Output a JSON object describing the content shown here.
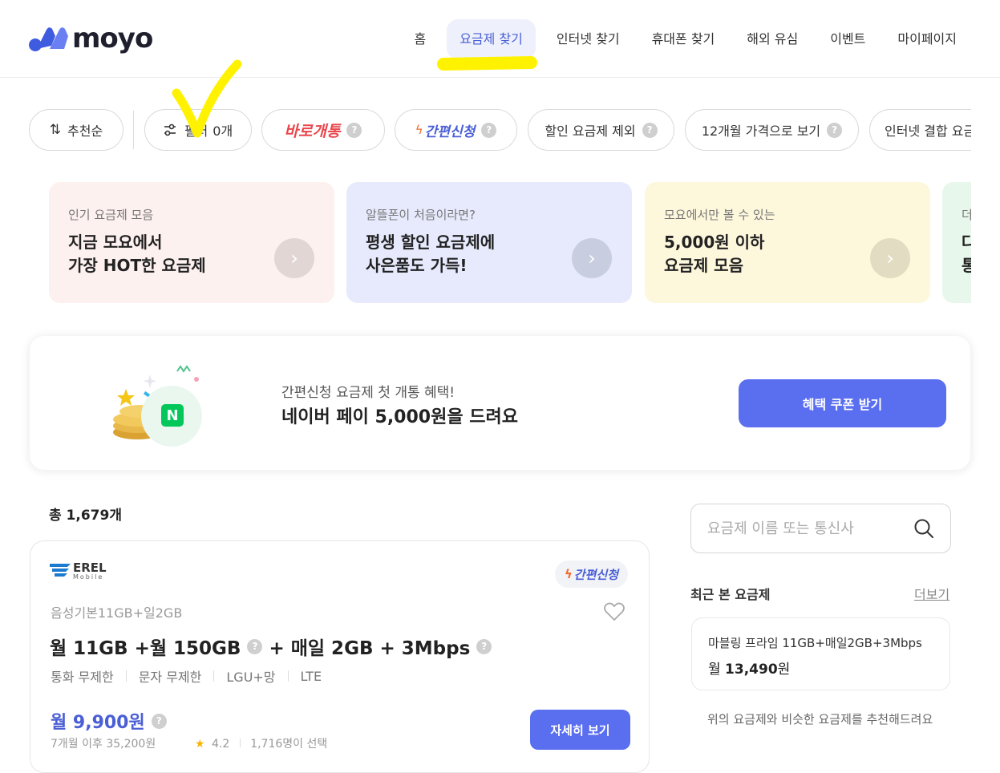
{
  "brand": {
    "name": "moyo"
  },
  "nav": {
    "items": [
      {
        "label": "홈"
      },
      {
        "label": "요금제 찾기"
      },
      {
        "label": "인터넷 찾기"
      },
      {
        "label": "휴대폰 찾기"
      },
      {
        "label": "해외 유심"
      },
      {
        "label": "이벤트"
      },
      {
        "label": "마이페이지"
      }
    ],
    "active_index": 1
  },
  "filters": {
    "sort_label": "추천순",
    "filter_label": "필터",
    "filter_count": "0개",
    "instant_open": "바로개통",
    "easy_apply": "간편신청",
    "exclude_discount": "할인 요금제 제외",
    "twelve_month": "12개월 가격으로 보기",
    "internet_bundle": "인터넷 결합 요금"
  },
  "promos": [
    {
      "sub": "인기 요금제 모음",
      "line1": "지금 모요에서",
      "line2": "가장 HOT한 요금제",
      "bg": "#fdf1f0",
      "arrow_bg": "#e2d6d5"
    },
    {
      "sub": "알뜰폰이 처음이라면?",
      "line1": "평생 할인 요금제에",
      "line2": "사은품도 가득!",
      "bg": "#e6eafc",
      "arrow_bg": "#c9cde0"
    },
    {
      "sub": "모요에서만 볼 수 있는",
      "line1": "5,000원 이하",
      "line2": "요금제 모음",
      "bg": "#fdf7dc",
      "arrow_bg": "#e2dcc2"
    },
    {
      "sub": "더",
      "line1": "다",
      "line2": "통",
      "bg": "#e8f7ec",
      "arrow_bg": "#cfe2d4"
    }
  ],
  "banner": {
    "sub": "간편신청 요금제 첫 개통 혜택!",
    "main": "네이버 페이 5,000원을 드려요",
    "button": "혜택 쿠폰 받기",
    "logo_letter": "N"
  },
  "results": {
    "total": "총 1,679개"
  },
  "plan": {
    "carrier_logo": "EREL",
    "carrier_logo_sub": "Mobile",
    "badge": "간편신청",
    "subtitle": "음성기본11GB+일2GB",
    "title_part1": "월 11GB +월 150GB",
    "title_part2": "+ 매일 2GB + 3Mbps",
    "specs": [
      "통화 무제한",
      "문자 무제한",
      "LGU+망",
      "LTE"
    ],
    "price": "월 9,900원",
    "price_note": "7개월 이후 35,200원",
    "rating": "4.2",
    "selected": "1,716명이 선택",
    "detail_button": "자세히 보기"
  },
  "search": {
    "placeholder": "요금제 이름 또는 통신사"
  },
  "recent": {
    "title": "최근 본 요금제",
    "more": "더보기",
    "item_name": "마블링 프라임 11GB+매일2GB+3Mbps",
    "item_price_prefix": "월",
    "item_price": "13,490",
    "item_price_suffix": "원",
    "recommend_note": "위의 요금제와 비슷한 요금제를 추천해드려요"
  },
  "colors": {
    "accent": "#5a6ef0",
    "accent_text": "#4a5fd6",
    "instant_red": "#e8474d",
    "annotation_yellow": "#fff200"
  }
}
